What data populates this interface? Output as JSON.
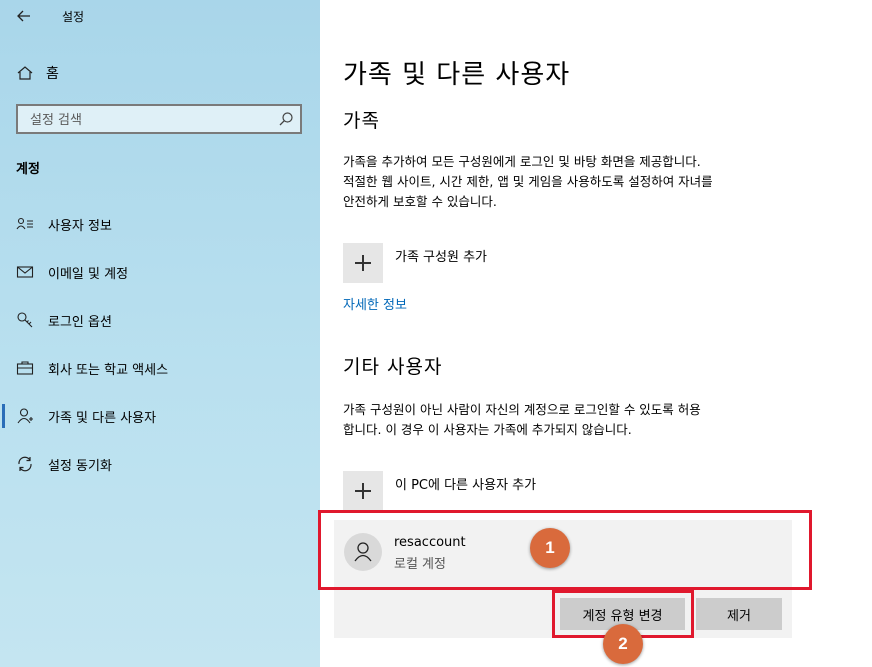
{
  "app": {
    "title": "설정"
  },
  "sidebar": {
    "home_label": "홈",
    "search_placeholder": "설정 검색",
    "section": "계정",
    "items": [
      {
        "label": "사용자 정보",
        "icon": "user-info-icon"
      },
      {
        "label": "이메일 및 계정",
        "icon": "mail-icon"
      },
      {
        "label": "로그인 옵션",
        "icon": "key-icon"
      },
      {
        "label": "회사 또는 학교 액세스",
        "icon": "briefcase-icon"
      },
      {
        "label": "가족 및 다른 사용자",
        "icon": "person-icon",
        "active": true
      },
      {
        "label": "설정 동기화",
        "icon": "sync-icon"
      }
    ]
  },
  "main": {
    "title": "가족 및 다른 사용자",
    "family": {
      "heading": "가족",
      "desc_lines": [
        "가족을 추가하여 모든 구성원에게 로그인 및 바탕 화면을 제공합니다.",
        "적절한 웹 사이트, 시간 제한, 앱 및 게임을 사용하도록 설정하여 자녀를",
        "안전하게 보호할 수 있습니다."
      ],
      "add_label": "가족 구성원 추가",
      "more_link": "자세한 정보"
    },
    "other": {
      "heading": "기타 사용자",
      "desc_lines": [
        "가족 구성원이 아닌 사람이 자신의 계정으로 로그인할 수 있도록 허용",
        "합니다. 이 경우 이 사용자는 가족에 추가되지 않습니다."
      ],
      "add_label": "이 PC에 다른 사용자 추가",
      "user": {
        "name": "resaccount",
        "type": "로컬 계정"
      },
      "change_type_button": "계정 유형 변경",
      "remove_button": "제거"
    }
  },
  "annotations": {
    "badge1": "1",
    "badge2": "2",
    "highlight_color": "#e0182d",
    "badge_color": "#d96a3c"
  },
  "colors": {
    "accent": "#0067b8",
    "active_bar": "#2a6db8"
  }
}
